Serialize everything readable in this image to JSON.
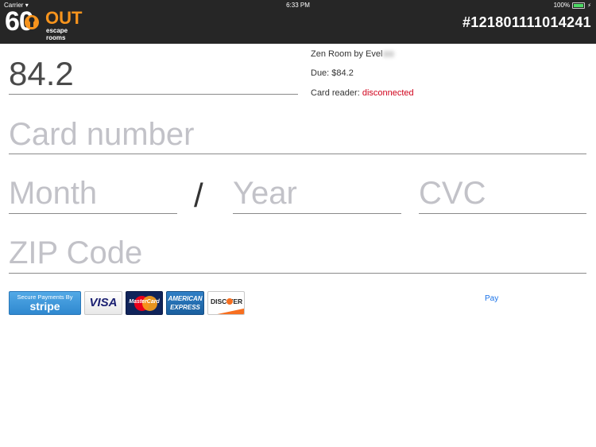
{
  "status_bar": {
    "carrier": "Carrier",
    "time": "6:33 PM",
    "battery": "100%"
  },
  "header": {
    "logo_number": "60",
    "logo_out": "OUT",
    "logo_subtitle": "escape rooms",
    "order_id": "#121801111014241"
  },
  "form": {
    "amount": "84.2",
    "card_number_placeholder": "Card number",
    "month_placeholder": "Month",
    "separator": "/",
    "year_placeholder": "Year",
    "cvc_placeholder": "CVC",
    "zip_placeholder": "ZIP Code"
  },
  "info": {
    "room": "Zen Room by Evel",
    "due": "Due: $84.2",
    "card_reader_label": "Card reader:",
    "card_reader_status": "disconnected",
    "status_color": "#d0021b"
  },
  "badges": {
    "stripe_line1": "Secure Payments By",
    "stripe_line2": "stripe",
    "visa": "VISA",
    "mastercard": "MasterCard",
    "amex_line1": "AMERICAN",
    "amex_line2": "EXPRESS",
    "discover": "DISC VER"
  },
  "actions": {
    "pay_label": "Pay"
  }
}
